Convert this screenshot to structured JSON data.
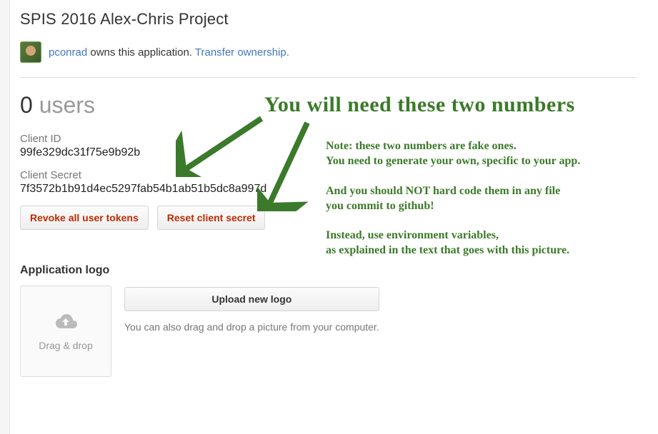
{
  "header": {
    "title": "SPIS 2016 Alex-Chris Project",
    "owner_username": "pconrad",
    "owns_text": " owns this application. ",
    "transfer_link": "Transfer ownership."
  },
  "users": {
    "count": "0",
    "word": "users"
  },
  "client_id": {
    "label": "Client ID",
    "value": "99fe329dc31f75e9b92b"
  },
  "client_secret": {
    "label": "Client Secret",
    "value": "7f3572b1b91d4ec5297fab54b1ab51b5dc8a997d"
  },
  "buttons": {
    "revoke": "Revoke all user tokens",
    "reset": "Reset client secret"
  },
  "logo_section": {
    "heading": "Application logo",
    "drop_label": "Drag & drop",
    "upload_button": "Upload new logo",
    "hint": "You can also drag and drop a picture from your computer."
  },
  "annotations": {
    "headline": "You will need these two numbers",
    "p1_l1": "Note: these two numbers are fake ones.",
    "p1_l2": "You need to generate your own, specific to your app.",
    "p2_l1": "And you should NOT hard code them in any file",
    "p2_l2": "you commit to github!",
    "p3_l1": "Instead, use environment variables,",
    "p3_l2": "as explained in the text that goes with this picture."
  },
  "colors": {
    "annotation_green": "#3b7a2a",
    "link_blue": "#4078c0",
    "danger_red": "#bd2c00"
  }
}
